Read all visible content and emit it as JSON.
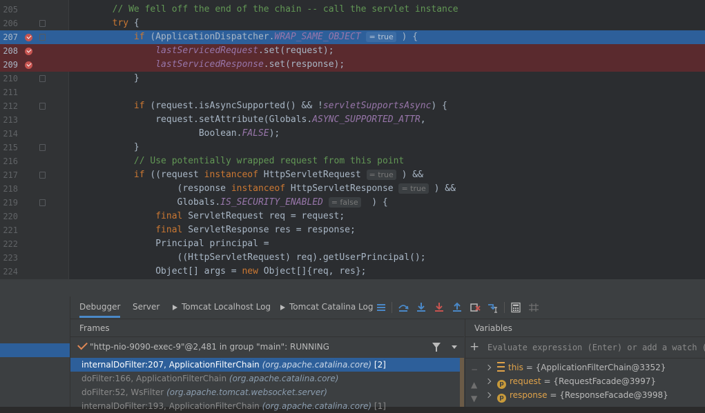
{
  "editor": {
    "lines": [
      {
        "num": "205",
        "state": "normal",
        "parts": [
          {
            "t": "        "
          },
          {
            "t": "// We fell off the end of the chain -- call the servlet instance",
            "c": "cm"
          }
        ]
      },
      {
        "num": "206",
        "state": "normal",
        "fold": true,
        "parts": [
          {
            "t": "        "
          },
          {
            "t": "try",
            "c": "kw"
          },
          {
            "t": " {"
          }
        ]
      },
      {
        "num": "207",
        "state": "selected",
        "breakpoint": true,
        "fold": true,
        "parts": [
          {
            "t": "            "
          },
          {
            "t": "if",
            "c": "kw"
          },
          {
            "t": " (ApplicationDispatcher."
          },
          {
            "t": "WRAP_SAME_OBJECT",
            "c": "fi"
          },
          {
            "t": " "
          },
          {
            "t": "= true",
            "c": "hint"
          },
          {
            "t": " ) {"
          }
        ]
      },
      {
        "num": "208",
        "state": "breakpoint",
        "breakpoint": true,
        "parts": [
          {
            "t": "                "
          },
          {
            "t": "lastServicedRequest",
            "c": "fi"
          },
          {
            "t": ".set(request);"
          }
        ]
      },
      {
        "num": "209",
        "state": "breakpoint",
        "breakpoint": true,
        "parts": [
          {
            "t": "                "
          },
          {
            "t": "lastServicedResponse",
            "c": "fi"
          },
          {
            "t": ".set(response);"
          }
        ]
      },
      {
        "num": "210",
        "state": "normal",
        "fold": true,
        "parts": [
          {
            "t": "            }"
          }
        ]
      },
      {
        "num": "211",
        "state": "normal",
        "parts": []
      },
      {
        "num": "212",
        "state": "normal",
        "fold": true,
        "parts": [
          {
            "t": "            "
          },
          {
            "t": "if",
            "c": "kw"
          },
          {
            "t": " (request.isAsyncSupported() && !"
          },
          {
            "t": "servletSupportsAsync",
            "c": "fi"
          },
          {
            "t": ") {"
          }
        ]
      },
      {
        "num": "213",
        "state": "normal",
        "parts": [
          {
            "t": "                request.setAttribute(Globals."
          },
          {
            "t": "ASYNC_SUPPORTED_ATTR",
            "c": "fi"
          },
          {
            "t": ","
          }
        ]
      },
      {
        "num": "214",
        "state": "normal",
        "parts": [
          {
            "t": "                        Boolean."
          },
          {
            "t": "FALSE",
            "c": "fi"
          },
          {
            "t": ");"
          }
        ]
      },
      {
        "num": "215",
        "state": "normal",
        "fold": true,
        "parts": [
          {
            "t": "            }"
          }
        ]
      },
      {
        "num": "216",
        "state": "normal",
        "parts": [
          {
            "t": "            "
          },
          {
            "t": "// Use potentially wrapped request from this point",
            "c": "cm"
          }
        ]
      },
      {
        "num": "217",
        "state": "normal",
        "fold": true,
        "parts": [
          {
            "t": "            "
          },
          {
            "t": "if",
            "c": "kw"
          },
          {
            "t": " ((request "
          },
          {
            "t": "instanceof",
            "c": "kw"
          },
          {
            "t": " HttpServletRequest "
          },
          {
            "t": "= true",
            "c": "hint"
          },
          {
            "t": " ) &&"
          }
        ]
      },
      {
        "num": "218",
        "state": "normal",
        "parts": [
          {
            "t": "                    (response "
          },
          {
            "t": "instanceof",
            "c": "kw"
          },
          {
            "t": " HttpServletResponse "
          },
          {
            "t": "= true",
            "c": "hint"
          },
          {
            "t": " ) &&"
          }
        ]
      },
      {
        "num": "219",
        "state": "normal",
        "fold": true,
        "parts": [
          {
            "t": "                    Globals."
          },
          {
            "t": "IS_SECURITY_ENABLED",
            "c": "fi"
          },
          {
            "t": " "
          },
          {
            "t": "= false",
            "c": "hint"
          },
          {
            "t": "  ) {"
          }
        ]
      },
      {
        "num": "220",
        "state": "normal",
        "parts": [
          {
            "t": "                "
          },
          {
            "t": "final",
            "c": "kw"
          },
          {
            "t": " ServletRequest req = request;"
          }
        ]
      },
      {
        "num": "221",
        "state": "normal",
        "parts": [
          {
            "t": "                "
          },
          {
            "t": "final",
            "c": "kw"
          },
          {
            "t": " ServletResponse res = response;"
          }
        ]
      },
      {
        "num": "222",
        "state": "normal",
        "parts": [
          {
            "t": "                Principal principal ="
          }
        ]
      },
      {
        "num": "223",
        "state": "normal",
        "parts": [
          {
            "t": "                    ((HttpServletRequest) req).getUserPrincipal();"
          }
        ]
      },
      {
        "num": "224",
        "state": "normal",
        "parts": [
          {
            "t": "                Object[] args = "
          },
          {
            "t": "new",
            "c": "kw"
          },
          {
            "t": " Object[]{req, res};"
          }
        ]
      }
    ]
  },
  "debug_tabs": [
    {
      "label": "Debugger",
      "active": true,
      "icon": ""
    },
    {
      "label": "Server",
      "active": false,
      "icon": ""
    },
    {
      "label": "Tomcat Localhost Log",
      "active": false,
      "icon": "console-icon"
    },
    {
      "label": "Tomcat Catalina Log",
      "active": false,
      "icon": "console-icon"
    }
  ],
  "toolbar_icons": [
    "show-execution-point-icon",
    "step-over-icon",
    "step-into-icon",
    "force-step-into-icon",
    "step-out-icon",
    "drop-frame-icon",
    "run-to-cursor-icon",
    "evaluate-expression-icon",
    "trace-icon"
  ],
  "frames": {
    "title": "Frames",
    "thread": "\"http-nio-9090-exec-9\"@2,481 in group \"main\": RUNNING",
    "items": [
      {
        "method": "internalDoFilter:207, ApplicationFilterChain",
        "pkg": "(org.apache.catalina.core)",
        "extra": "[2]",
        "selected": true
      },
      {
        "method": "doFilter:166, ApplicationFilterChain",
        "pkg": "(org.apache.catalina.core)",
        "extra": "",
        "selected": false
      },
      {
        "method": "doFilter:52, WsFilter",
        "pkg": "(org.apache.tomcat.websocket.server)",
        "extra": "",
        "selected": false
      },
      {
        "method": "internalDoFilter:193, ApplicationFilterChain",
        "pkg": "(org.apache.catalina.core)",
        "extra": "[1]",
        "selected": false
      }
    ]
  },
  "variables": {
    "title": "Variables",
    "eval_placeholder": "Evaluate expression (Enter) or add a watch (Ctrl+Shift+Enter)",
    "items": [
      {
        "name": "this",
        "value": "{ApplicationFilterChain@3352}",
        "icon": "list-icon"
      },
      {
        "name": "request",
        "value": "{RequestFacade@3997}",
        "icon": "p"
      },
      {
        "name": "response",
        "value": "{ResponseFacade@3998}",
        "icon": "p"
      }
    ]
  },
  "colors": {
    "selection": "#2d5f9a",
    "breakpoint_line": "#5a2a2e",
    "keyword": "#cc7832",
    "comment": "#629755",
    "field": "#9876aa"
  }
}
